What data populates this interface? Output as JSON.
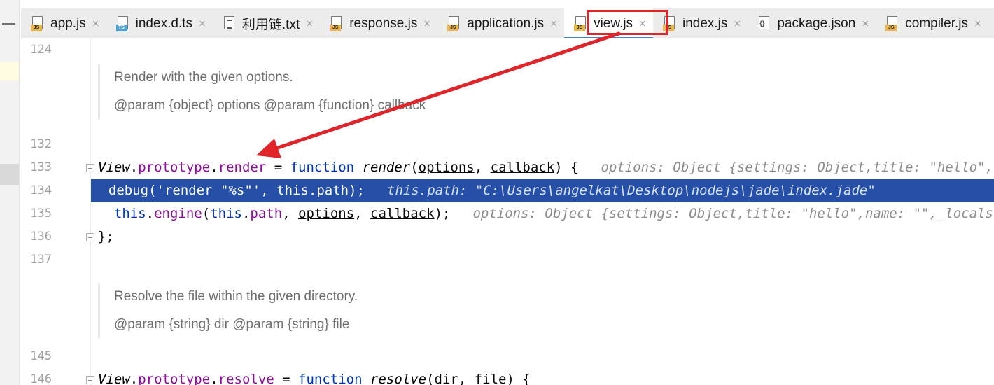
{
  "tabs": [
    {
      "label": "app.js",
      "icon": "js-file-icon",
      "type": "js"
    },
    {
      "label": "index.d.ts",
      "icon": "ts-file-icon",
      "type": "ts"
    },
    {
      "label": "利用链.txt",
      "icon": "text-file-icon",
      "type": "txt"
    },
    {
      "label": "response.js",
      "icon": "js-file-icon",
      "type": "js"
    },
    {
      "label": "application.js",
      "icon": "js-file-icon",
      "type": "js"
    },
    {
      "label": "view.js",
      "icon": "js-file-icon",
      "type": "js",
      "active": true
    },
    {
      "label": "index.js",
      "icon": "js-file-icon",
      "type": "js"
    },
    {
      "label": "package.json",
      "icon": "json-file-icon",
      "type": "json"
    },
    {
      "label": "compiler.js",
      "icon": "js-file-icon",
      "type": "js"
    }
  ],
  "tab_close_glyph": "×",
  "lines": {
    "n124": "124",
    "n132": "132",
    "n133": "133",
    "n134": "134",
    "n135": "135",
    "n136": "136",
    "n137": "137",
    "n145": "145",
    "n146": "146"
  },
  "doc1": {
    "summary": "Render with the given options.",
    "params": "@param {object} options @param {function} callback"
  },
  "doc2": {
    "summary": "Resolve the file within the given directory.",
    "params": "@param {string} dir @param {string} file"
  },
  "code": {
    "l133": {
      "cls": "View",
      "dot1": ".",
      "proto": "prototype",
      "dot2": ".",
      "name": "render",
      "eq": " = ",
      "kw": "function",
      "sp": " ",
      "fn": "render",
      "open": "(",
      "p1": "options",
      "comma": ", ",
      "p2": "callback",
      "close": ") {",
      "hint": "options: Object {settings: Object,title: \"hello\",name: \"\",_locals: Object,cache: false}"
    },
    "l134": {
      "indent": "  ",
      "call": "debug(",
      "str": "'render \"%s\"'",
      "mid": ", ",
      "kw": "this",
      "dot": ".",
      "prop": "path",
      "end": ");",
      "hint": "this.path: \"C:\\Users\\angelkat\\Desktop\\nodejs\\jade\\index.jade\""
    },
    "l135": {
      "indent": "  ",
      "kw1": "this",
      "dot1": ".",
      "prop1": "engine",
      "open": "(",
      "kw2": "this",
      "dot2": ".",
      "prop2": "path",
      "comma1": ", ",
      "p1": "options",
      "comma2": ", ",
      "p2": "callback",
      "end": ");",
      "hint": "options: Object {settings: Object,title: \"hello\",name: \"\",_locals: Object,cache: false}"
    },
    "l136": "};",
    "l146": {
      "cls": "View",
      "dot1": ".",
      "proto": "prototype",
      "dot2": ".",
      "name": "resolve",
      "eq": " = ",
      "kw": "function",
      "sp": " ",
      "fn": "resolve",
      "rest": "(dir, file) {"
    }
  },
  "colors": {
    "selection": "#2650a8",
    "keyword": "#0033b3",
    "property": "#871094",
    "string": "#067d17",
    "annotation_arrow": "#e0242a",
    "active_tab_underline": "#4083c9"
  }
}
